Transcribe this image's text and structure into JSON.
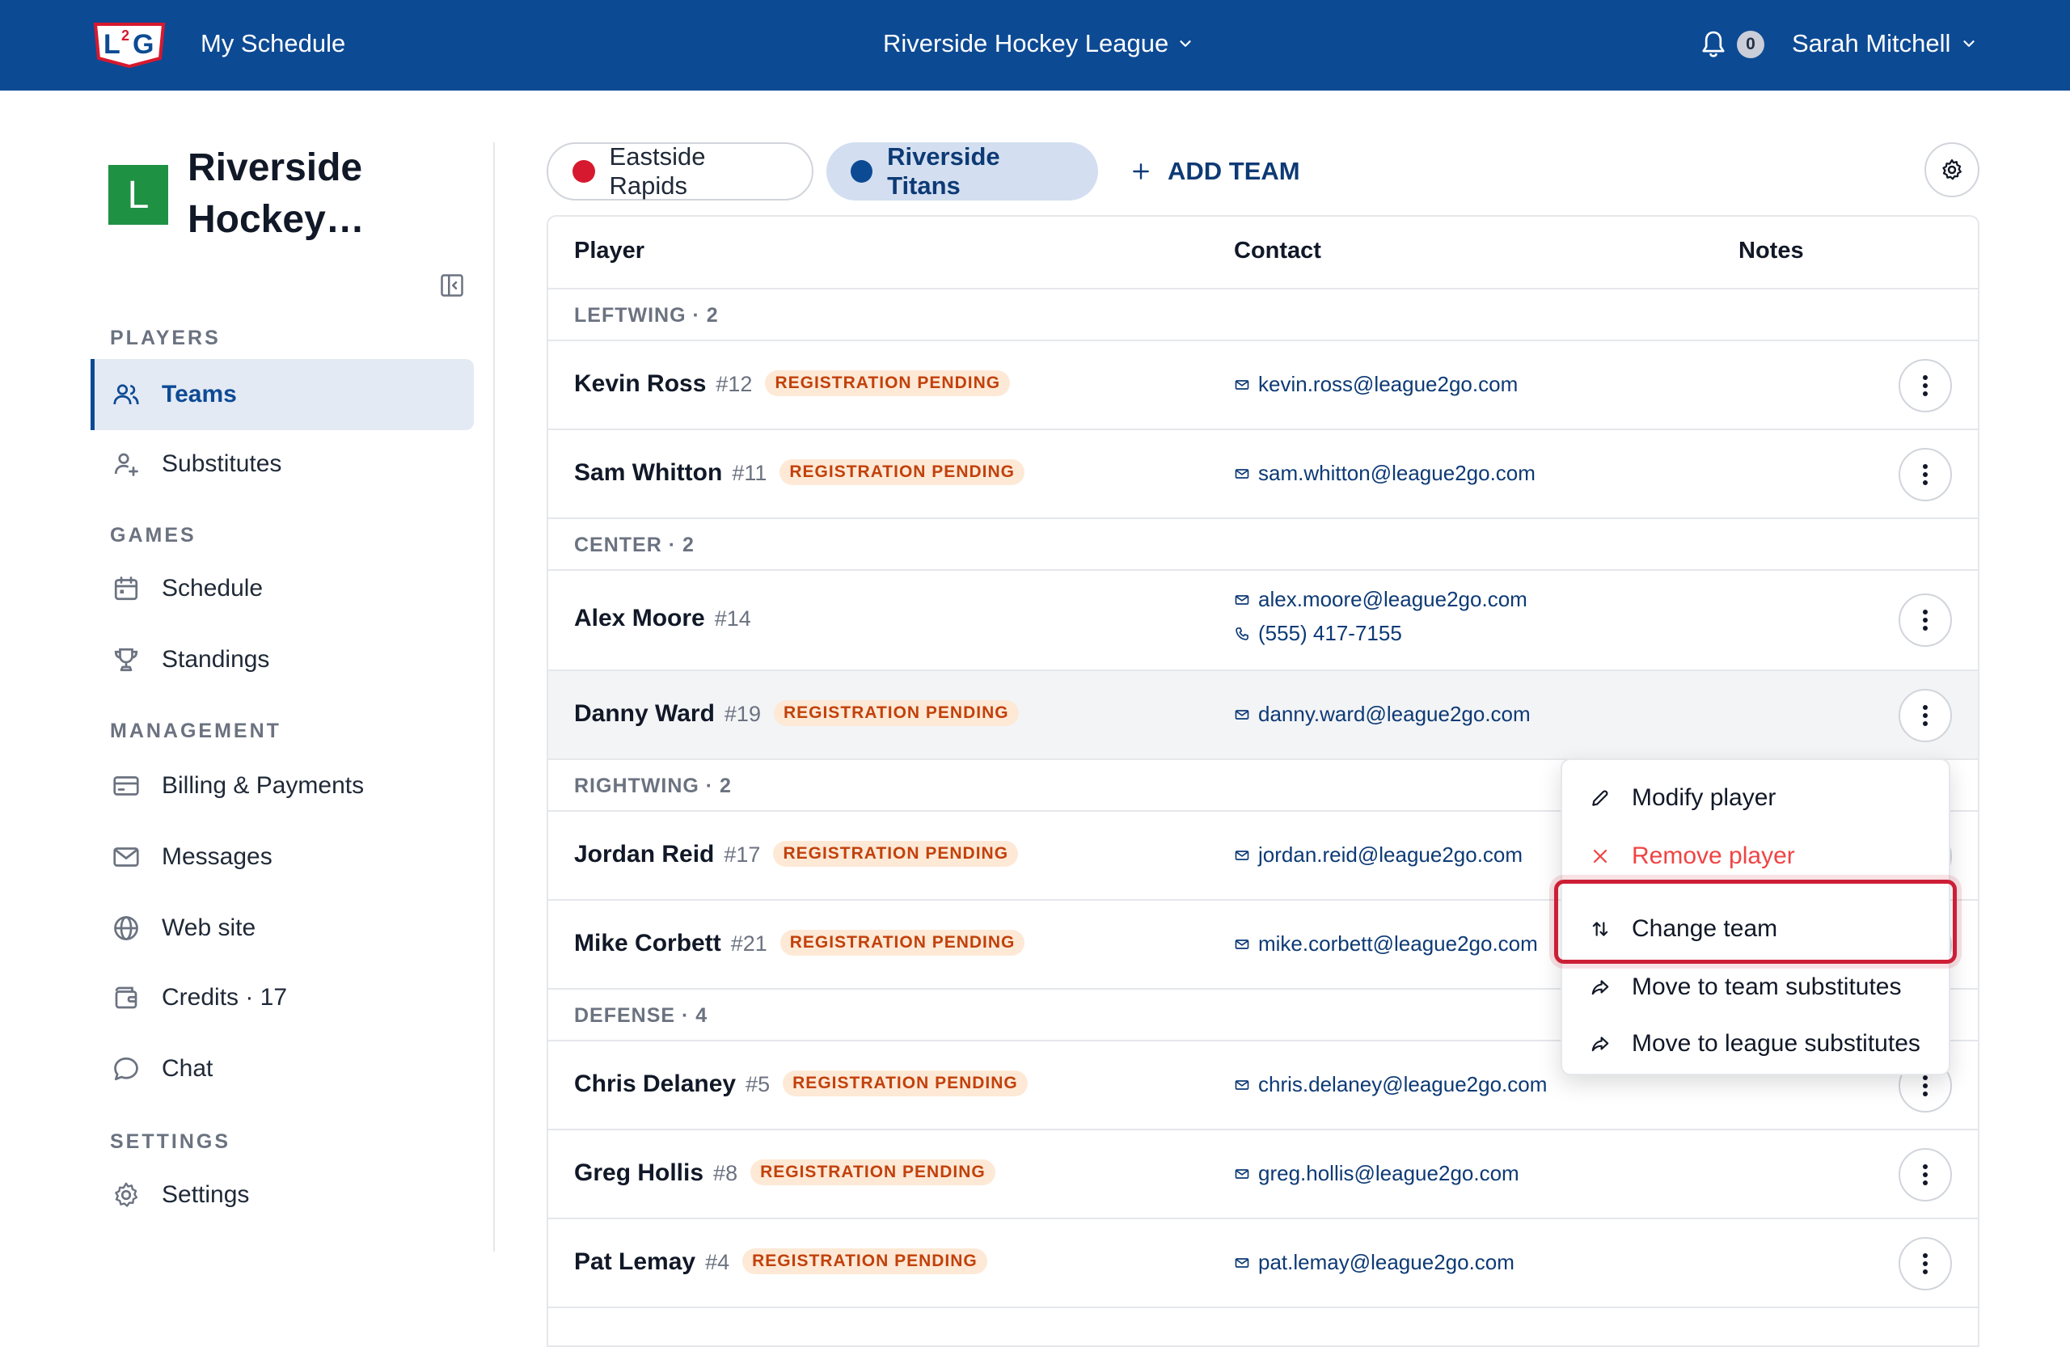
{
  "topbar": {
    "my_schedule": "My Schedule",
    "league": "Riverside Hockey League",
    "notifications": "0",
    "user": "Sarah Mitchell"
  },
  "sidebar": {
    "org_initial": "L",
    "org_name": "Riverside Hockey…",
    "sections": {
      "players": "PLAYERS",
      "games": "GAMES",
      "management": "MANAGEMENT",
      "settings": "SETTINGS"
    },
    "items": {
      "teams": "Teams",
      "substitutes": "Substitutes",
      "schedule": "Schedule",
      "standings": "Standings",
      "billing": "Billing & Payments",
      "messages": "Messages",
      "website": "Web site",
      "credits": "Credits · 17",
      "chat": "Chat",
      "settings": "Settings"
    }
  },
  "team_tabs": {
    "tab1": "Eastside Rapids",
    "tab2": "Riverside Titans",
    "add": "ADD TEAM"
  },
  "colors": {
    "brand": "#0d4a94",
    "eastside": "#d7192f",
    "riverside": "#0d4a94",
    "badge_text": "#c2410c",
    "badge_bg": "#fde9d6",
    "danger": "#ef4444",
    "highlight": "#cc1f36"
  },
  "table": {
    "headers": {
      "player": "Player",
      "contact": "Contact",
      "notes": "Notes"
    },
    "groups": {
      "leftwing": "LEFTWING · 2",
      "center": "CENTER · 2",
      "rightwing": "RIGHTWING · 2",
      "defense": "DEFENSE · 4"
    },
    "badge": "REGISTRATION PENDING",
    "players": {
      "p1": {
        "name": "Kevin Ross",
        "num": "#12",
        "email": "kevin.ross@league2go.com"
      },
      "p2": {
        "name": "Sam Whitton",
        "num": "#11",
        "email": "sam.whitton@league2go.com"
      },
      "p3": {
        "name": "Alex Moore",
        "num": "#14",
        "email": "alex.moore@league2go.com",
        "phone": "(555) 417-7155"
      },
      "p4": {
        "name": "Danny Ward",
        "num": "#19",
        "email": "danny.ward@league2go.com"
      },
      "p5": {
        "name": "Jordan Reid",
        "num": "#17",
        "email": "jordan.reid@league2go.com"
      },
      "p6": {
        "name": "Mike Corbett",
        "num": "#21",
        "email": "mike.corbett@league2go.com"
      },
      "p7": {
        "name": "Chris Delaney",
        "num": "#5",
        "email": "chris.delaney@league2go.com"
      },
      "p8": {
        "name": "Greg Hollis",
        "num": "#8",
        "email": "greg.hollis@league2go.com"
      },
      "p9": {
        "name": "Pat Lemay",
        "num": "#4",
        "email": "pat.lemay@league2go.com"
      }
    }
  },
  "context_menu": {
    "modify": "Modify player",
    "remove": "Remove player",
    "change_team": "Change team",
    "team_subs": "Move to team substitutes",
    "league_subs": "Move to league substitutes"
  }
}
